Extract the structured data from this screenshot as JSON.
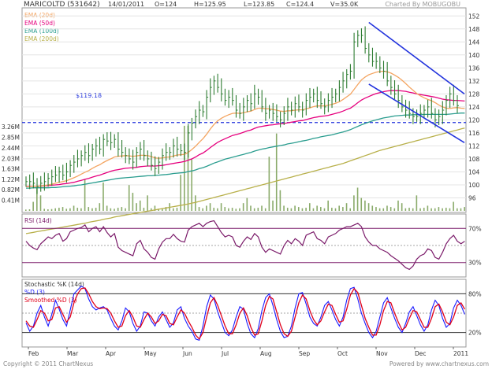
{
  "header": {
    "symbol": "MARICOLTD (531642)",
    "date": "14/01/2011",
    "open": "O=124",
    "high": "H=125.95",
    "low": "L=123.85",
    "close": "C=124.4",
    "volume": "V=35.0K",
    "charted_by": "Charted By MOBUGOBU"
  },
  "footer": {
    "copyright": "Copyright © 2011 ChartNexus",
    "url": "Powered by www.chartnexus.com"
  },
  "colors": {
    "ema20": "#f4a460",
    "ema50": "#e6007e",
    "ema100": "#2a9d8f",
    "ema200": "#b8b04a",
    "price": "#2e7d32",
    "volume": "#8aab6a",
    "rsi": "#7b1b6a",
    "pctd": "#1a1aff",
    "smoothed": "#e0001a",
    "channel": "#2233dd",
    "support": "#2233dd"
  },
  "chart_data": [
    {
      "type": "line",
      "title": "MARICOLTD (531642)",
      "legend": [
        "EMA (20d)",
        "EMA (50d)",
        "EMA (100d)",
        "EMA (200d)"
      ],
      "legend_placement": "top-left",
      "x_ticks": [
        "Feb",
        "Mar",
        "Apr",
        "May",
        "Jun",
        "Jul",
        "Aug",
        "Sep",
        "Oct",
        "Nov",
        "Dec",
        "2011"
      ],
      "y_ticks": [
        96,
        100,
        104,
        108,
        112,
        116,
        120,
        124,
        128,
        132,
        136,
        140,
        144,
        148,
        152
      ],
      "ylim": [
        92,
        154
      ],
      "support_label": "$119.18",
      "support_value": 119.18,
      "price_close": [
        101,
        101,
        100.5,
        99.5,
        100.5,
        101,
        102,
        102.5,
        103,
        104,
        103,
        104,
        106,
        107,
        108,
        109,
        110,
        109,
        111,
        112,
        111,
        114,
        113.5,
        113,
        114,
        111,
        110,
        109,
        108,
        107,
        110,
        111,
        109,
        108,
        106,
        105,
        107,
        109,
        110,
        110,
        112,
        111,
        110.5,
        110,
        116,
        119,
        121,
        123,
        122.5,
        127,
        130,
        132,
        130,
        128,
        126,
        127,
        126,
        123,
        122,
        124,
        126,
        125,
        128,
        127,
        124,
        122,
        123,
        122,
        121,
        120,
        122,
        124,
        123,
        125,
        124,
        123,
        126,
        127,
        128,
        126,
        125,
        124,
        126,
        127,
        128,
        130,
        132,
        134,
        135,
        144,
        146,
        146,
        142,
        140,
        138,
        138,
        136,
        135,
        132,
        130,
        128,
        126,
        124,
        123,
        122,
        121,
        121,
        122,
        123,
        124,
        122,
        120,
        121,
        123,
        126,
        128,
        126,
        124.4
      ],
      "ema_20": [
        99.4,
        99.5,
        99.6,
        99.6,
        99.7,
        99.8,
        100.0,
        100.2,
        100.5,
        100.8,
        101.0,
        101.3,
        101.7,
        102.2,
        102.7,
        103.3,
        103.9,
        104.4,
        105.1,
        105.7,
        106.2,
        106.9,
        107.5,
        108.0,
        108.6,
        108.8,
        108.9,
        109.0,
        108.9,
        108.8,
        108.9,
        109.1,
        109.1,
        109.0,
        108.7,
        108.3,
        108.2,
        108.3,
        108.5,
        108.6,
        108.9,
        109.2,
        109.3,
        109.4,
        110.0,
        110.9,
        111.9,
        113.1,
        114.2,
        115.6,
        117.2,
        118.6,
        119.7,
        120.5,
        121.1,
        121.6,
        122.0,
        122.1,
        122.0,
        122.2,
        122.5,
        122.7,
        123.2,
        123.6,
        123.6,
        123.4,
        123.4,
        123.2,
        123.0,
        122.7,
        122.6,
        122.8,
        122.8,
        123.0,
        123.1,
        123.1,
        123.4,
        123.7,
        124.1,
        124.3,
        124.3,
        124.3,
        124.5,
        124.8,
        125.1,
        125.6,
        126.3,
        127.1,
        127.9,
        129.4,
        130.9,
        132.3,
        133.2,
        133.9,
        134.3,
        134.7,
        134.9,
        135.0,
        134.8,
        134.4,
        133.8,
        133.1,
        132.2,
        131.2,
        130.1,
        129.1,
        128.1,
        127.4,
        126.8,
        126.3,
        125.9,
        125.3,
        124.6,
        124.0,
        123.6,
        123.5,
        123.7,
        123.8,
        123.6,
        123.5
      ],
      "ema_50": [
        99.5,
        99.6,
        99.6,
        99.6,
        99.6,
        99.7,
        99.8,
        99.9,
        100.0,
        100.1,
        100.3,
        100.4,
        100.6,
        100.8,
        101.1,
        101.4,
        101.7,
        102.0,
        102.4,
        102.7,
        103.0,
        103.4,
        103.8,
        104.2,
        104.5,
        104.7,
        104.9,
        105.1,
        105.2,
        105.3,
        105.4,
        105.6,
        105.7,
        105.8,
        105.8,
        105.8,
        105.9,
        106.0,
        106.2,
        106.4,
        106.6,
        106.8,
        107.0,
        107.2,
        107.6,
        108.0,
        108.6,
        109.3,
        109.8,
        110.6,
        111.5,
        112.3,
        113.1,
        113.7,
        114.2,
        114.7,
        115.2,
        115.5,
        115.8,
        116.2,
        116.6,
        116.9,
        117.4,
        117.8,
        118.0,
        118.2,
        118.4,
        118.5,
        118.7,
        118.8,
        118.9,
        119.1,
        119.3,
        119.5,
        119.7,
        119.8,
        120.1,
        120.4,
        120.7,
        120.9,
        121.1,
        121.2,
        121.4,
        121.7,
        122.0,
        122.3,
        122.7,
        123.2,
        123.6,
        124.4,
        125.3,
        126.1,
        126.7,
        127.2,
        127.7,
        128.1,
        128.4,
        128.7,
        128.9,
        129.0,
        129.0,
        129.0,
        128.9,
        128.8,
        128.5,
        128.3,
        128.0,
        127.8,
        127.6,
        127.4,
        127.2,
        127.0,
        126.7,
        126.4,
        126.2,
        126.1,
        126.0,
        126.0,
        125.9,
        125.8
      ],
      "ema_100": [
        99.0,
        99.0,
        99.1,
        99.1,
        99.1,
        99.1,
        99.1,
        99.2,
        99.2,
        99.3,
        99.4,
        99.5,
        99.6,
        99.7,
        99.9,
        100.0,
        100.2,
        100.4,
        100.6,
        100.8,
        101.0,
        101.2,
        101.4,
        101.6,
        101.8,
        102.0,
        102.1,
        102.2,
        102.3,
        102.4,
        102.5,
        102.6,
        102.7,
        102.8,
        102.8,
        102.9,
        103.0,
        103.1,
        103.2,
        103.3,
        103.5,
        103.6,
        103.7,
        103.8,
        104.1,
        104.3,
        104.6,
        105.0,
        105.3,
        105.7,
        106.2,
        106.7,
        107.1,
        107.5,
        107.9,
        108.2,
        108.5,
        108.8,
        109.1,
        109.4,
        109.7,
        110.0,
        110.4,
        110.7,
        111.0,
        111.2,
        111.5,
        111.7,
        111.9,
        112.1,
        112.3,
        112.6,
        112.8,
        113.0,
        113.3,
        113.5,
        113.7,
        114.0,
        114.3,
        114.5,
        114.8,
        115.0,
        115.2,
        115.4,
        115.7,
        116.0,
        116.3,
        116.6,
        117.0,
        117.5,
        118.0,
        118.5,
        118.9,
        119.3,
        119.7,
        120.0,
        120.3,
        120.6,
        120.8,
        121.0,
        121.2,
        121.3,
        121.4,
        121.5,
        121.5,
        121.6,
        121.6,
        121.6,
        121.7,
        121.7,
        121.7,
        121.7,
        121.7,
        121.7,
        121.7,
        121.8,
        121.9,
        122.0,
        122.1,
        122.1
      ],
      "ema_200": [
        85.0,
        85.2,
        85.4,
        85.6,
        85.8,
        86.0,
        86.2,
        86.4,
        86.6,
        86.8,
        87.0,
        87.2,
        87.4,
        87.6,
        87.8,
        88.0,
        88.2,
        88.5,
        88.7,
        88.9,
        89.1,
        89.4,
        89.6,
        89.8,
        90.1,
        90.3,
        90.5,
        90.7,
        90.9,
        91.1,
        91.3,
        91.5,
        91.7,
        91.9,
        92.1,
        92.3,
        92.5,
        92.7,
        92.9,
        93.1,
        93.3,
        93.5,
        93.7,
        93.9,
        94.1,
        94.4,
        94.6,
        94.9,
        95.2,
        95.5,
        95.8,
        96.1,
        96.4,
        96.7,
        97.0,
        97.3,
        97.6,
        97.9,
        98.2,
        98.5,
        98.8,
        99.1,
        99.4,
        99.7,
        100.0,
        100.3,
        100.6,
        100.9,
        101.2,
        101.5,
        101.8,
        102.1,
        102.4,
        102.7,
        103.0,
        103.3,
        103.6,
        103.9,
        104.2,
        104.5,
        104.8,
        105.1,
        105.4,
        105.7,
        106.0,
        106.3,
        106.6,
        107.0,
        107.4,
        107.8,
        108.2,
        108.6,
        109.0,
        109.4,
        109.8,
        110.2,
        110.6,
        110.9,
        111.2,
        111.5,
        111.8,
        112.1,
        112.4,
        112.7,
        113.0,
        113.3,
        113.6,
        113.9,
        114.2,
        114.5,
        114.8,
        115.1,
        115.4,
        115.7,
        116.0,
        116.3,
        116.6,
        116.9,
        117.2,
        117.5
      ],
      "channel_upper": [
        [
          93,
          150
        ],
        [
          120,
          128
        ]
      ],
      "channel_lower": [
        [
          93,
          131
        ],
        [
          120,
          113
        ]
      ]
    },
    {
      "type": "bar",
      "series_name": "Volume",
      "y_ticks": [
        "0.41M",
        "0.82M",
        "1.22M",
        "1.63M",
        "2.03M",
        "2.44M",
        "2.85M",
        "3.26M"
      ],
      "ylim": [
        0,
        3.6
      ],
      "values": [
        0.05,
        0.06,
        0.35,
        0.9,
        0.6,
        0.08,
        0.06,
        0.07,
        0.1,
        0.12,
        0.15,
        0.08,
        0.1,
        0.2,
        0.12,
        0.1,
        1.22,
        0.15,
        0.1,
        0.12,
        0.3,
        1.1,
        0.2,
        0.1,
        0.08,
        0.12,
        0.15,
        0.1,
        1.0,
        0.7,
        0.3,
        0.4,
        0.12,
        0.6,
        0.1,
        0.2,
        0.08,
        0.1,
        0.15,
        0.3,
        0.1,
        0.12,
        1.4,
        3.3,
        3.3,
        2.0,
        0.6,
        0.15,
        0.1,
        0.2,
        0.3,
        0.12,
        0.1,
        0.3,
        0.15,
        0.1,
        0.12,
        0.08,
        0.1,
        0.3,
        0.5,
        0.2,
        0.1,
        0.12,
        0.2,
        0.1,
        2.1,
        0.4,
        3.0,
        0.8,
        0.2,
        0.12,
        0.1,
        0.2,
        0.15,
        0.1,
        0.12,
        0.3,
        0.1,
        0.2,
        0.15,
        0.1,
        0.4,
        0.12,
        0.1,
        0.2,
        0.15,
        0.3,
        0.1,
        0.6,
        0.9,
        0.5,
        0.4,
        0.3,
        0.2,
        0.15,
        0.1,
        0.1,
        0.2,
        0.15,
        0.1,
        0.4,
        0.3,
        0.1,
        0.12,
        0.1,
        0.6,
        0.1,
        0.12,
        0.2,
        0.1,
        0.1,
        0.15,
        0.1,
        0.12,
        0.1,
        0.35,
        0.1,
        0.1,
        0.15
      ]
    },
    {
      "type": "line",
      "title": "RSI (14d)",
      "y_ticks": [
        "70%",
        "30%"
      ],
      "levels": [
        70,
        50,
        30
      ],
      "ylim": [
        15,
        85
      ],
      "values": [
        55,
        50,
        47,
        45,
        52,
        56,
        60,
        58,
        62,
        64,
        55,
        58,
        66,
        68,
        70,
        71,
        74,
        66,
        70,
        72,
        66,
        72,
        65,
        60,
        64,
        48,
        44,
        42,
        40,
        38,
        52,
        56,
        46,
        42,
        36,
        34,
        46,
        54,
        58,
        58,
        63,
        58,
        55,
        54,
        68,
        72,
        74,
        76,
        72,
        76,
        78,
        79,
        72,
        65,
        60,
        62,
        60,
        50,
        48,
        55,
        60,
        57,
        64,
        60,
        48,
        42,
        46,
        44,
        42,
        40,
        50,
        56,
        52,
        58,
        55,
        50,
        62,
        64,
        66,
        58,
        56,
        52,
        60,
        62,
        64,
        68,
        70,
        72,
        72,
        74,
        76,
        72,
        60,
        54,
        50,
        50,
        46,
        44,
        42,
        38,
        35,
        32,
        28,
        24,
        22,
        26,
        34,
        38,
        40,
        46,
        44,
        36,
        34,
        42,
        52,
        58,
        62,
        55,
        52,
        55
      ]
    },
    {
      "type": "line",
      "title": "Stochastic %K (14d)",
      "legend": [
        "%D (3)",
        "Smoothed %D (3)"
      ],
      "y_ticks": [
        "80%",
        "20%"
      ],
      "levels": [
        80,
        50,
        20
      ],
      "ylim": [
        0,
        100
      ],
      "pct_d": [
        35,
        22,
        30,
        50,
        62,
        44,
        30,
        48,
        70,
        56,
        40,
        30,
        55,
        80,
        86,
        92,
        88,
        72,
        60,
        55,
        58,
        60,
        55,
        42,
        30,
        24,
        38,
        58,
        52,
        34,
        22,
        30,
        52,
        50,
        38,
        30,
        44,
        52,
        40,
        28,
        35,
        55,
        60,
        42,
        30,
        22,
        10,
        8,
        30,
        60,
        78,
        72,
        52,
        36,
        20,
        15,
        24,
        44,
        60,
        56,
        34,
        18,
        12,
        26,
        54,
        74,
        80,
        62,
        40,
        22,
        12,
        14,
        30,
        58,
        80,
        82,
        64,
        44,
        34,
        30,
        44,
        62,
        68,
        55,
        40,
        30,
        44,
        70,
        88,
        90,
        72,
        50,
        34,
        20,
        12,
        22,
        44,
        66,
        74,
        58,
        42,
        28,
        20,
        34,
        52,
        60,
        46,
        32,
        22,
        32,
        55,
        70,
        62,
        42,
        28,
        34,
        58,
        70,
        62,
        48
      ],
      "smoothed_pct_d": [
        38,
        30,
        28,
        40,
        54,
        50,
        38,
        40,
        58,
        60,
        48,
        36,
        44,
        66,
        80,
        88,
        89,
        80,
        68,
        60,
        57,
        58,
        57,
        50,
        38,
        28,
        30,
        46,
        54,
        44,
        30,
        28,
        40,
        50,
        44,
        34,
        38,
        48,
        46,
        34,
        32,
        44,
        55,
        50,
        38,
        28,
        16,
        10,
        20,
        44,
        66,
        74,
        62,
        46,
        30,
        18,
        18,
        32,
        50,
        58,
        46,
        28,
        16,
        18,
        38,
        62,
        76,
        72,
        52,
        32,
        18,
        14,
        22,
        44,
        66,
        78,
        72,
        54,
        40,
        32,
        38,
        52,
        64,
        62,
        48,
        36,
        38,
        56,
        78,
        88,
        82,
        62,
        42,
        28,
        16,
        16,
        32,
        54,
        68,
        66,
        50,
        36,
        24,
        28,
        42,
        54,
        52,
        40,
        28,
        28,
        42,
        60,
        64,
        52,
        36,
        32,
        44,
        62,
        66,
        56
      ]
    }
  ]
}
